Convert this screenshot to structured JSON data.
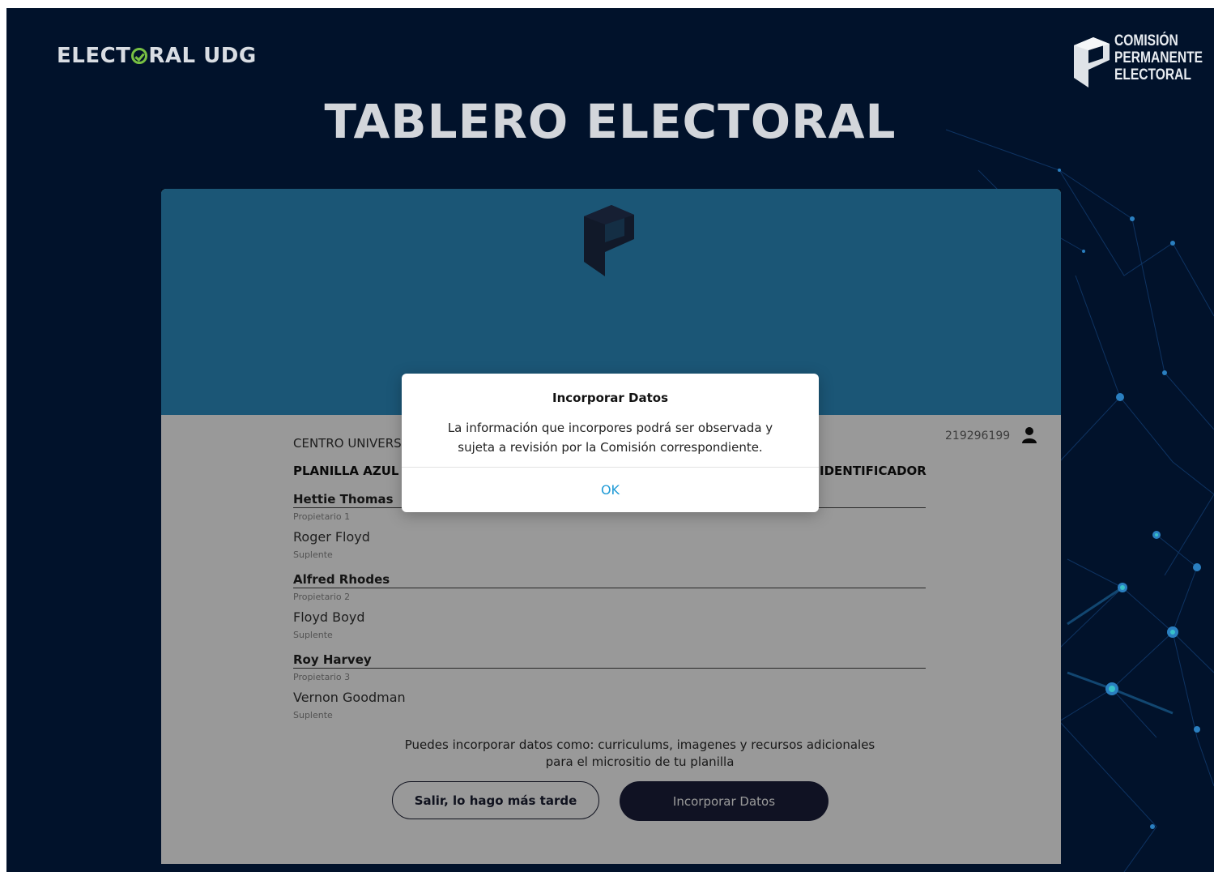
{
  "header": {
    "brand_left_pre": "ELECT",
    "brand_left_post": "RAL UDG",
    "brand_right_line1": "COMISIÓN",
    "brand_right_line2": "PERMANENTE",
    "brand_right_line3": "ELECTORAL",
    "page_title": "TABLERO ELECTORAL"
  },
  "card": {
    "center_label": "CENTRO UNIVERSITARIO",
    "user_id": "219296199",
    "planilla_label": "PLANILLA AZUL",
    "identifier_label": "IDENTIFICADOR",
    "members": [
      {
        "owner": "Hettie Thomas",
        "role": "Propietario 1",
        "substitute": "Roger Floyd",
        "substitute_role": "Suplente"
      },
      {
        "owner": "Alfred Rhodes",
        "role": "Propietario 2",
        "substitute": "Floyd Boyd",
        "substitute_role": "Suplente"
      },
      {
        "owner": "Roy Harvey",
        "role": "Propietario 3",
        "substitute": "Vernon Goodman",
        "substitute_role": "Suplente"
      }
    ],
    "info_line1": "Puedes incorporar datos como: curriculums, imagenes y recursos adicionales",
    "info_line2": "para el micrositio de tu planilla",
    "later_button": "Salir, lo hago más tarde",
    "add_button": "Incorporar Datos"
  },
  "dialog": {
    "title": "Incorporar Datos",
    "message_line1": "La información que incorpores podrá ser observada y",
    "message_line2": "sujeta a revisión por la Comisión correspondiente.",
    "ok_label": "OK"
  },
  "colors": {
    "background": "#01122b",
    "header_band": "#2d8fc5",
    "brand_accent": "#78c043",
    "primary_button": "#1b1f3b",
    "dialog_ok": "#1e9ad6"
  }
}
